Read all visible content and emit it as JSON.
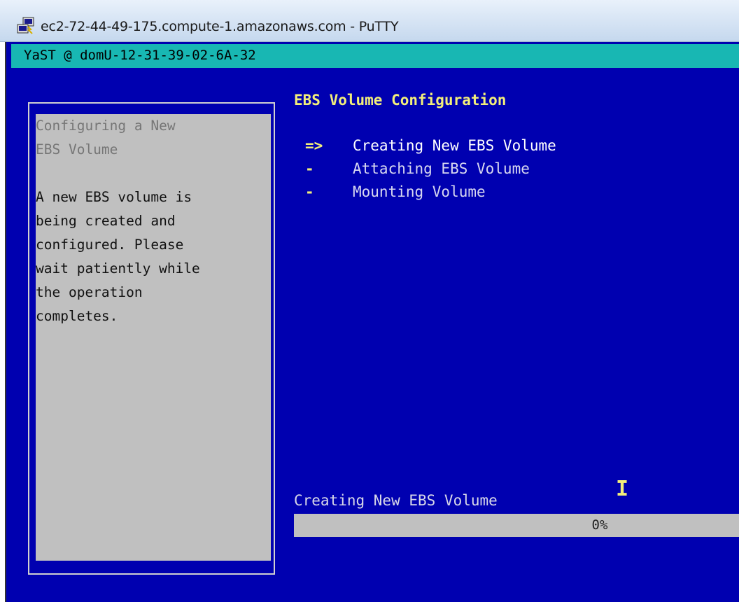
{
  "window": {
    "title": "ec2-72-44-49-175.compute-1.amazonaws.com - PuTTY",
    "app_icon": "putty-icon"
  },
  "terminal": {
    "header": "YaST @ domU-12-31-39-02-6A-32",
    "colors": {
      "background": "#0000b0",
      "header_bar": "#18b7b3",
      "title": "#f3ef7a",
      "help_panel": "#c0c0c0"
    }
  },
  "help": {
    "heading_lines": [
      "Configuring a New",
      "EBS Volume"
    ],
    "body_lines": [
      "A new EBS volume is",
      "being created and",
      "configured. Please",
      "wait patiently while",
      "the operation",
      "completes."
    ]
  },
  "main": {
    "title": "EBS Volume Configuration",
    "steps": [
      {
        "marker": "=>",
        "label": "Creating New EBS Volume",
        "status": "current"
      },
      {
        "marker": "-",
        "label": "Attaching EBS Volume",
        "status": "pending"
      },
      {
        "marker": "-",
        "label": "Mounting Volume",
        "status": "pending"
      }
    ]
  },
  "progress": {
    "label": "Creating New EBS Volume",
    "text": "0%",
    "percent": 0
  },
  "text_cursor": "I"
}
